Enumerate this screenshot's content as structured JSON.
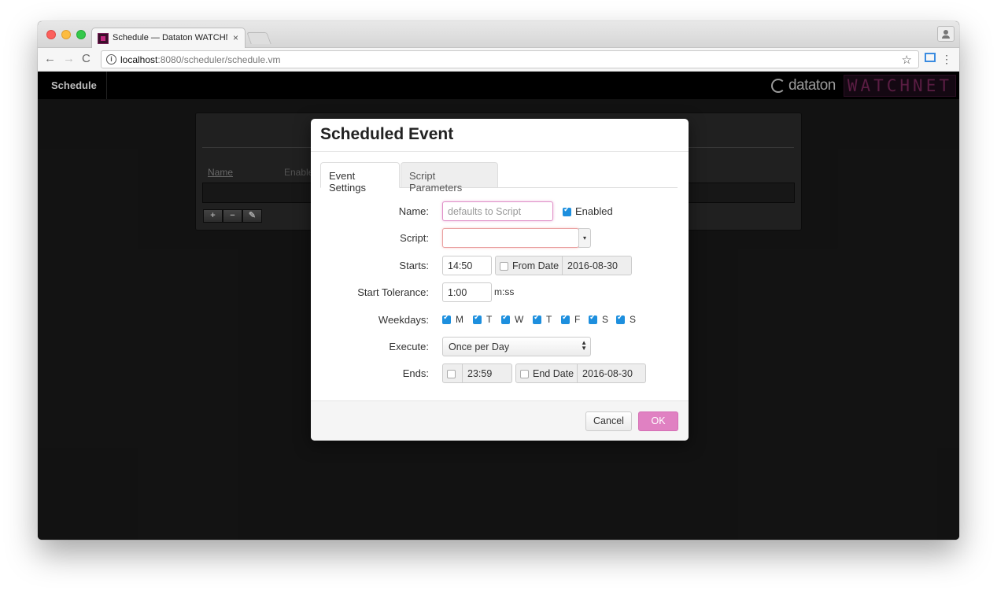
{
  "browser": {
    "tab_title": "Schedule — Dataton WATCHNET",
    "tab_close": "×",
    "url_host": "localhost",
    "url_rest": ":8080/scheduler/schedule.vm",
    "back": "←",
    "forward": "→",
    "reload": "C",
    "star": "☆",
    "menu": "⋮",
    "info": "i"
  },
  "app": {
    "title": "Schedule",
    "brand_company": "dataton",
    "brand_product": "WATCHNET",
    "colors": {
      "accent": "#e081c2",
      "checkbox": "#1d8fde",
      "background": "#191919"
    }
  },
  "panel": {
    "col_name": "Name",
    "col_enabled": "Enable",
    "buttons": {
      "add": "+",
      "remove": "−",
      "edit": "✎"
    }
  },
  "modal": {
    "title": "Scheduled Event",
    "tabs": [
      "Event Settings",
      "Script Parameters"
    ],
    "name": {
      "label": "Name:",
      "placeholder": "defaults to Script",
      "enabled_label": "Enabled",
      "enabled": true
    },
    "script": {
      "label": "Script:",
      "value": "",
      "dropdown": "▾"
    },
    "starts": {
      "label": "Starts:",
      "time": "14:50",
      "from_date_label": "From Date",
      "from_date_checked": false,
      "from_date": "2016-08-30"
    },
    "tolerance": {
      "label": "Start Tolerance:",
      "value": "1:00",
      "unit": "m:ss"
    },
    "weekdays": {
      "label": "Weekdays:",
      "days": [
        {
          "label": "M",
          "checked": true
        },
        {
          "label": "T",
          "checked": true
        },
        {
          "label": "W",
          "checked": true
        },
        {
          "label": "T",
          "checked": true
        },
        {
          "label": "F",
          "checked": true
        },
        {
          "label": "S",
          "checked": true
        },
        {
          "label": "S",
          "checked": true
        }
      ]
    },
    "execute": {
      "label": "Execute:",
      "value": "Once per Day",
      "arrows": "▲▼"
    },
    "ends": {
      "label": "Ends:",
      "time_checked": false,
      "time": "23:59",
      "end_date_label": "End Date",
      "end_date_checked": false,
      "end_date": "2016-08-30"
    },
    "buttons": {
      "cancel": "Cancel",
      "ok": "OK"
    }
  }
}
